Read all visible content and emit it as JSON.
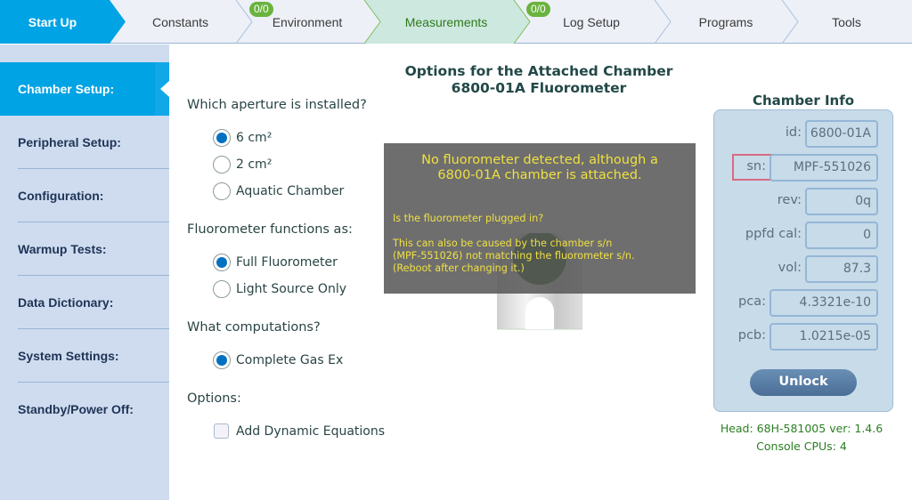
{
  "topnav": {
    "tabs": [
      {
        "label": "Start Up",
        "state": "active"
      },
      {
        "label": "Constants",
        "state": "normal"
      },
      {
        "label": "Environment",
        "state": "normal",
        "badge": "0/0"
      },
      {
        "label": "Measurements",
        "state": "highlighted"
      },
      {
        "label": "Log Setup",
        "state": "normal",
        "badge": "0/0"
      },
      {
        "label": "Programs",
        "state": "normal"
      },
      {
        "label": "Tools",
        "state": "normal"
      }
    ],
    "colors": {
      "active": "#00a3e4",
      "highlighted": "#cde8df",
      "badge": "#6ab33e"
    }
  },
  "sidebar": {
    "items": [
      {
        "label": "Chamber Setup:",
        "active": true
      },
      {
        "label": "Peripheral Setup:"
      },
      {
        "label": "Configuration:"
      },
      {
        "label": "Warmup Tests:"
      },
      {
        "label": "Data Dictionary:"
      },
      {
        "label": "System Settings:"
      },
      {
        "label": "Standby/Power Off:"
      }
    ]
  },
  "main": {
    "title_line1": "Options for the Attached Chamber",
    "title_line2": "6800-01A Fluorometer",
    "aperture": {
      "question": "Which aperture is installed?",
      "options": [
        {
          "label": "6 cm²",
          "selected": true
        },
        {
          "label": "2 cm²",
          "selected": false
        },
        {
          "label": "Aquatic Chamber",
          "selected": false
        }
      ]
    },
    "fluorometer": {
      "question": "Fluorometer functions as:",
      "options": [
        {
          "label": "Full Fluorometer",
          "selected": true
        },
        {
          "label": "Light Source Only",
          "selected": false
        }
      ]
    },
    "computations": {
      "question": "What computations?",
      "options": [
        {
          "label": "Complete Gas Ex",
          "selected": true
        }
      ]
    },
    "options": {
      "label": "Options:",
      "checkboxes": [
        {
          "label": "Add Dynamic Equations",
          "checked": false
        }
      ]
    }
  },
  "overlay": {
    "heading_line1": "No fluorometer detected, although a",
    "heading_line2": "6800-01A chamber is attached.",
    "line1": "Is the fluorometer plugged in?",
    "line2": "This can also be caused by the chamber s/n",
    "line3": "(MPF-551026) not matching the fluorometer s/n.",
    "line4": "(Reboot after changing it.)"
  },
  "chamber_info": {
    "title": "Chamber Info",
    "fields": [
      {
        "label": "id:",
        "value": "6800-01A"
      },
      {
        "label": "sn:",
        "value": "MPF-551026",
        "error": true
      },
      {
        "label": "rev:",
        "value": "0q"
      },
      {
        "label": "ppfd cal:",
        "value": "0"
      },
      {
        "label": "vol:",
        "value": "87.3"
      },
      {
        "label": "pca:",
        "value": "4.3321e-10"
      },
      {
        "label": "pcb:",
        "value": "1.0215e-05"
      }
    ],
    "unlock_label": "Unlock"
  },
  "status": {
    "head": "Head: 68H-581005 ver: 1.4.6",
    "console": "Console CPUs: 4"
  }
}
